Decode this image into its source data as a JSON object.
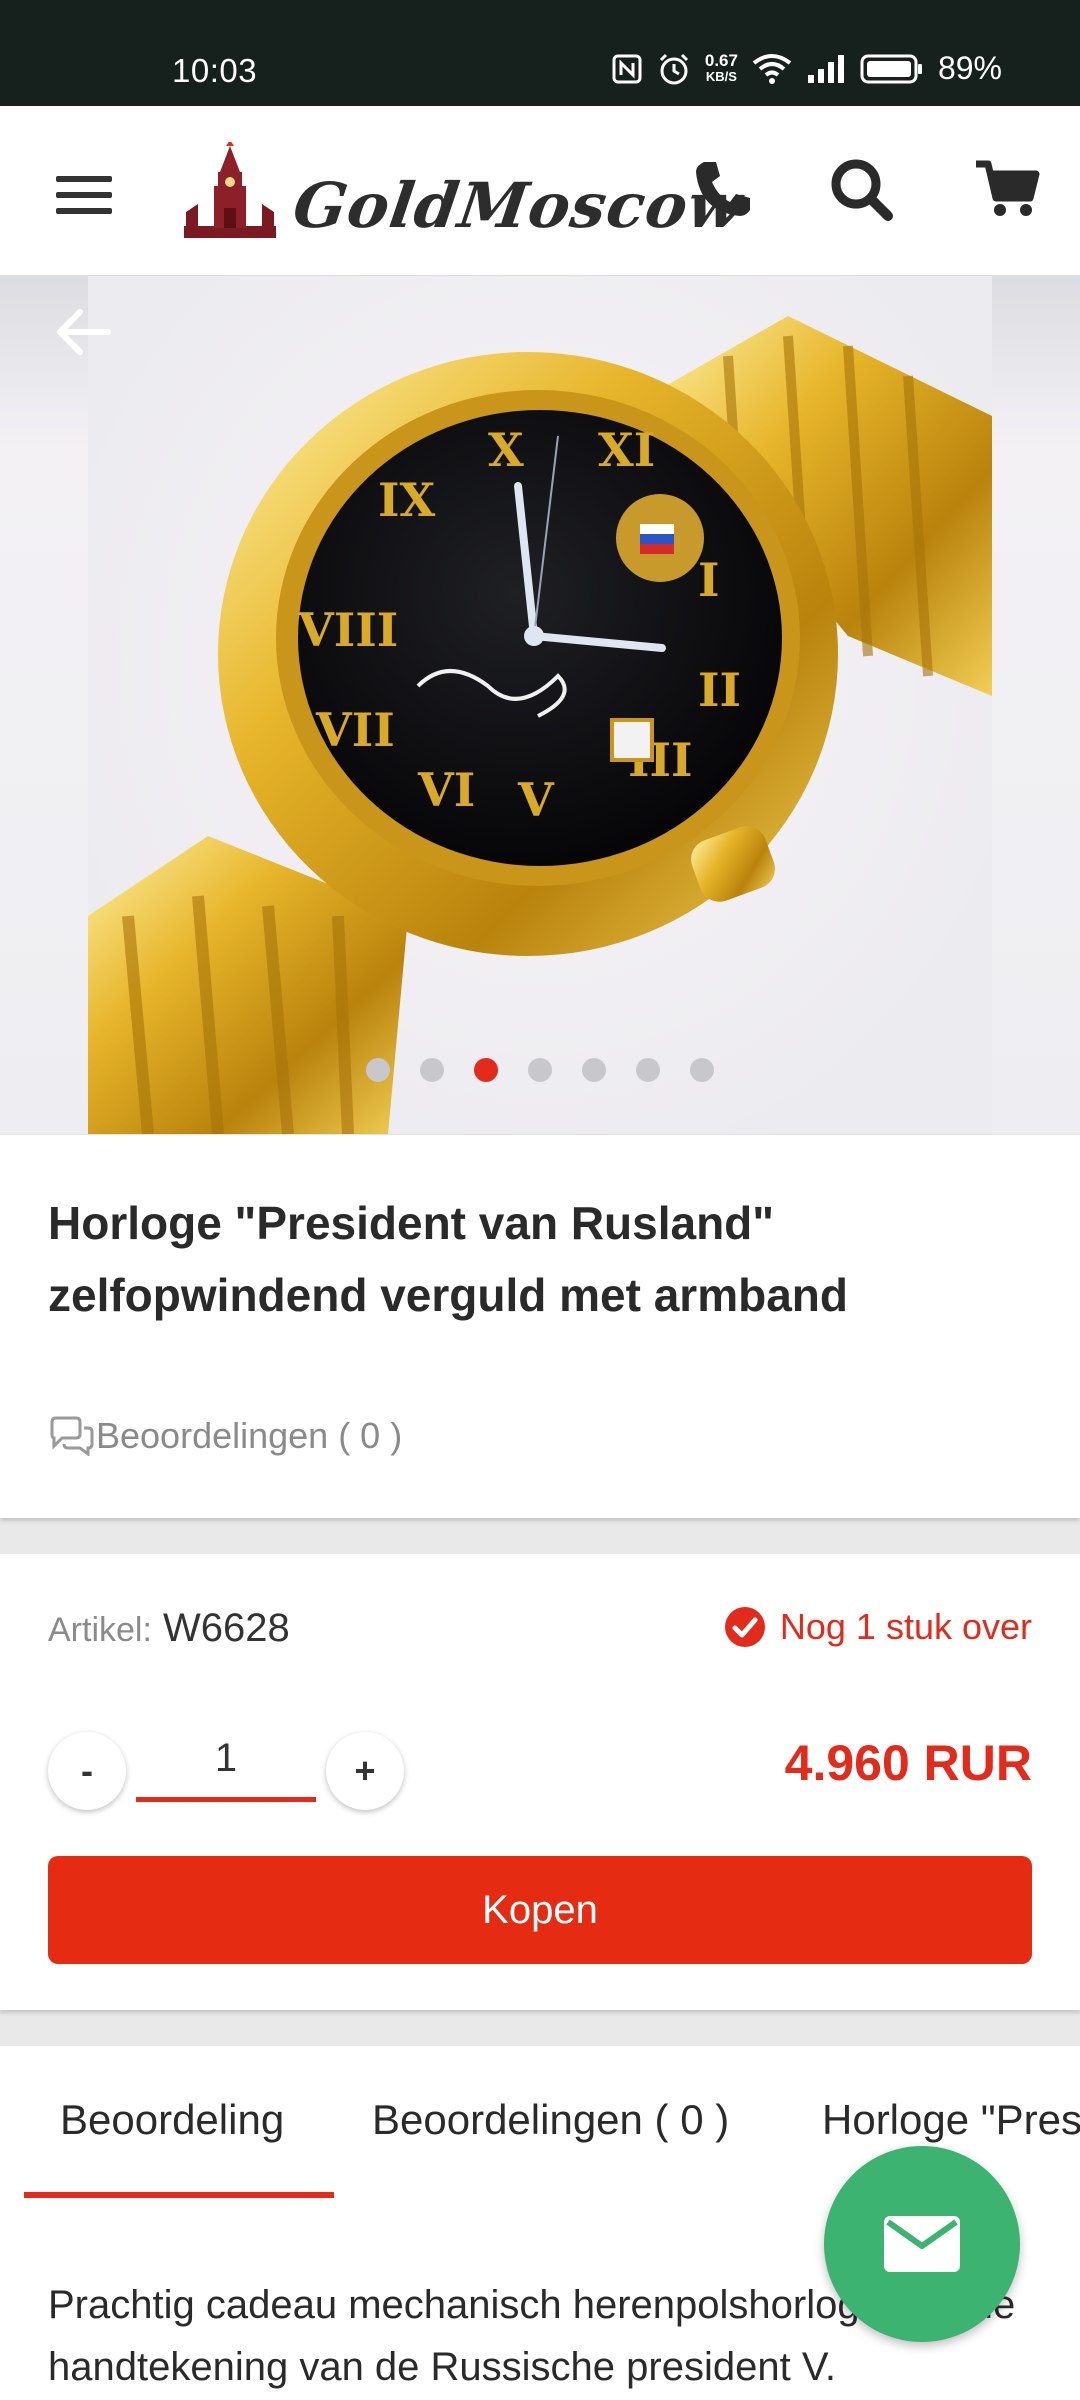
{
  "status_bar": {
    "time": "10:03",
    "net_speed": "0.67",
    "net_unit": "KB/S",
    "battery": "89%"
  },
  "header": {
    "brand": "GoldMoscow",
    "icons": [
      "menu-icon",
      "kremlin-logo",
      "phone-icon",
      "search-icon",
      "cart-icon"
    ]
  },
  "gallery": {
    "image_count": 7,
    "active_index": 2
  },
  "product": {
    "title": "Horloge \"President van Rusland\" zelfopwindend verguld met armband",
    "reviews_link": "Beoordelingen ( 0 )"
  },
  "purchase": {
    "sku_label": "Artikel:",
    "sku_value": "W6628",
    "stock_text": "Nog 1 stuk over",
    "qty_minus": "-",
    "qty_value": "1",
    "qty_plus": "+",
    "price": "4.960 RUR",
    "buy_label": "Kopen"
  },
  "tabs": [
    {
      "label": "Beoordeling"
    },
    {
      "label": "Beoordelingen ( 0 )"
    },
    {
      "label": "Horloge \"President van Rusland\" zelfopwindend verguld met armband"
    }
  ],
  "description": {
    "text": "Prachtig cadeau mechanisch herenpolshorloge met de handtekening van de Russische president V."
  },
  "colors": {
    "accent": "#e32b1b",
    "fab": "#3cb371",
    "status_bar": "#16211d"
  }
}
